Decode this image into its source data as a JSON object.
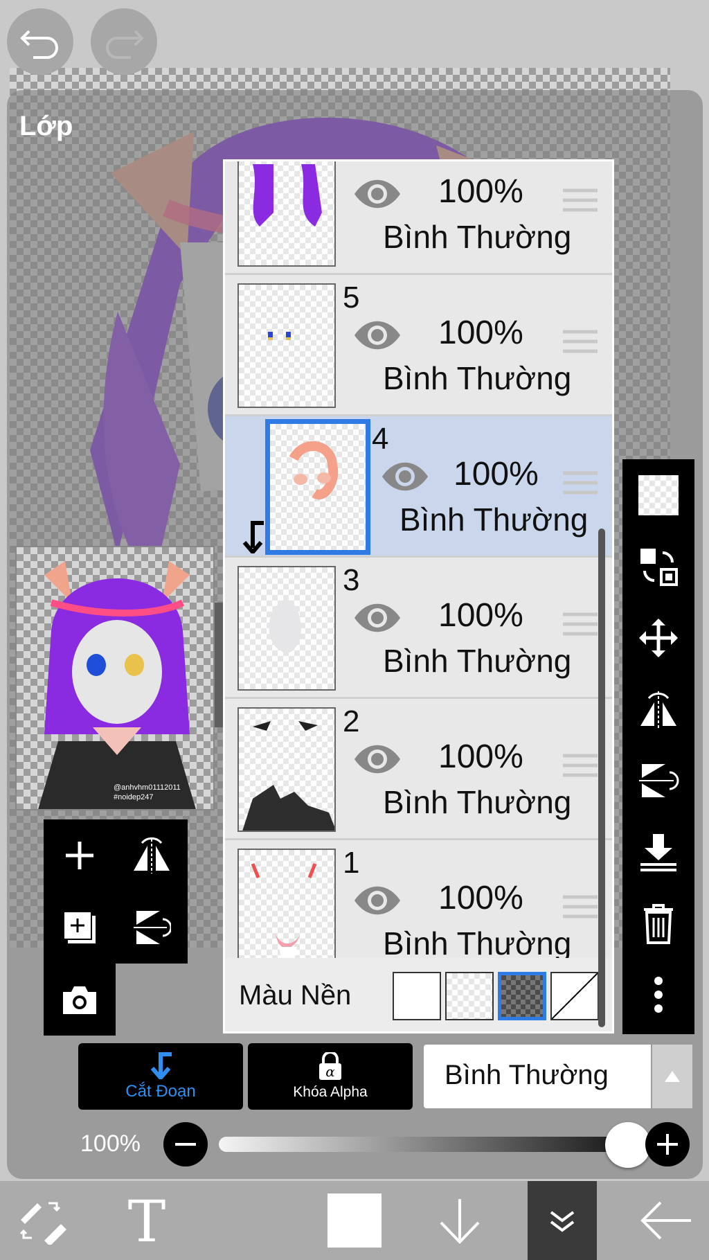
{
  "panel": {
    "title": "Lớp"
  },
  "preview": {
    "caption_line1": "@anhvhm01112011",
    "caption_line2": "#noidep247"
  },
  "layers": [
    {
      "number": "",
      "opacity": "100%",
      "blend": "Bình Thường",
      "visible": true,
      "selected": false,
      "clipped": false,
      "thumbnail": "hair-purple"
    },
    {
      "number": "5",
      "opacity": "100%",
      "blend": "Bình Thường",
      "visible": true,
      "selected": false,
      "clipped": false,
      "thumbnail": "eyes-blue"
    },
    {
      "number": "4",
      "opacity": "100%",
      "blend": "Bình Thường",
      "visible": true,
      "selected": true,
      "clipped": true,
      "thumbnail": "face-shading"
    },
    {
      "number": "3",
      "opacity": "100%",
      "blend": "Bình Thường",
      "visible": true,
      "selected": false,
      "clipped": false,
      "thumbnail": "skin-white"
    },
    {
      "number": "2",
      "opacity": "100%",
      "blend": "Bình Thường",
      "visible": true,
      "selected": false,
      "clipped": false,
      "thumbnail": "lineart-dark"
    },
    {
      "number": "1",
      "opacity": "100%",
      "blend": "Bình Thường",
      "visible": true,
      "selected": false,
      "clipped": false,
      "thumbnail": "blush-pink"
    }
  ],
  "background_row": {
    "label": "Màu Nền",
    "options": [
      "white",
      "checker",
      "dark-checker",
      "none"
    ],
    "selected": "dark-checker"
  },
  "buttons": {
    "cut_label": "Cắt Đoạn",
    "alpha_label": "Khóa Alpha"
  },
  "blend_select": {
    "value": "Bình Thường"
  },
  "opacity": {
    "label": "100%",
    "value": 1.0
  },
  "colors": {
    "accent": "#2e7be3",
    "selected_row": "#c9d6ec",
    "toolbar": "#000000"
  },
  "right_tools": [
    "checker-icon",
    "layer-move-icon",
    "move-arrows-icon",
    "flip-horizontal-icon",
    "flip-vertical-icon",
    "merge-down-icon",
    "trash-icon",
    "more-icon"
  ],
  "bottom_tools": [
    "brush-eraser-icon",
    "text-icon",
    "color-swatch-icon",
    "arrow-down-icon",
    "layers-collapse-icon",
    "back-icon"
  ]
}
